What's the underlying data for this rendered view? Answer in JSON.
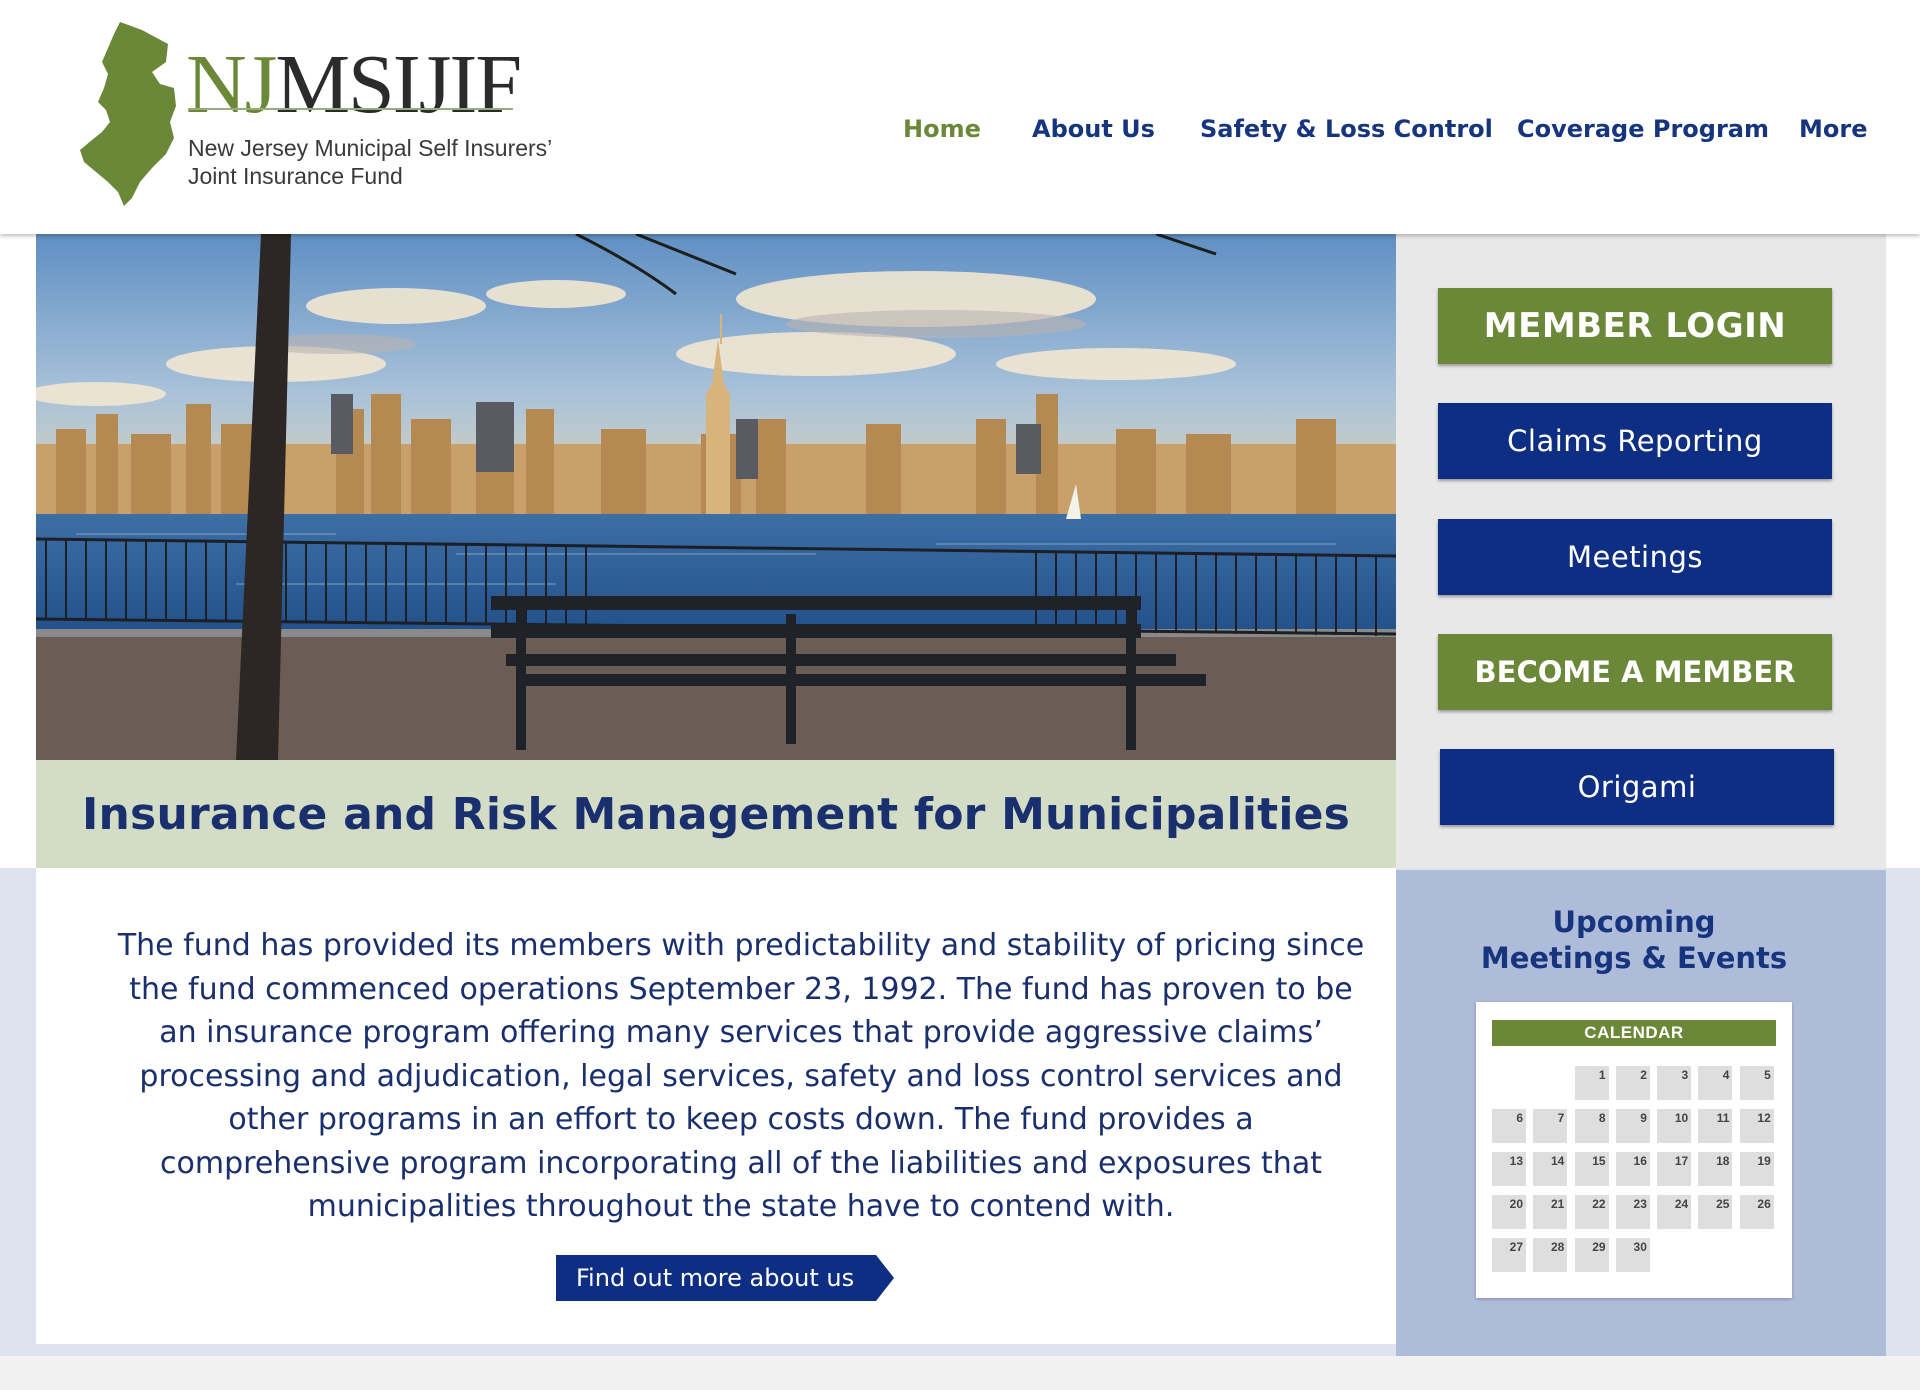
{
  "header": {
    "logo": {
      "wordmark_nj": "NJ",
      "wordmark_rest": "MSIJIF",
      "subtitle_line1": "New Jersey Municipal Self Insurers’",
      "subtitle_line2": "Joint Insurance Fund"
    },
    "nav": [
      {
        "label": "Home",
        "active": true
      },
      {
        "label": "About Us",
        "active": false
      },
      {
        "label": "Safety & Loss Control",
        "active": false
      },
      {
        "label": "Coverage Program",
        "active": false
      },
      {
        "label": "More",
        "active": false
      }
    ]
  },
  "hero": {
    "tagline": "Insurance and Risk Management for Municipalities"
  },
  "sidebar": {
    "buttons": [
      {
        "label": "MEMBER LOGIN",
        "style": "green"
      },
      {
        "label": "Claims Reporting",
        "style": "blue"
      },
      {
        "label": "Meetings",
        "style": "blue"
      },
      {
        "label": "BECOME A MEMBER",
        "style": "green"
      },
      {
        "label": "Origami",
        "style": "blue"
      }
    ]
  },
  "about": {
    "body": "The fund has provided its members with predictability and stability of pricing since the fund commenced operations September 23, 1992. The fund has proven to be an insurance program offering many services that provide aggressive claims’ processing and adjudication, legal services, safety and loss control services and other programs in an effort to keep costs down. The fund provides a comprehensive program incorporating all of the liabilities and exposures that municipalities throughout the state have to contend with.",
    "cta_label": "Find out more about us"
  },
  "events": {
    "title_line1": "Upcoming",
    "title_line2": "Meetings & Events",
    "calendar": {
      "header": "CALENDAR",
      "leading_blanks": 2,
      "days": [
        "1",
        "2",
        "3",
        "4",
        "5",
        "6",
        "7",
        "8",
        "9",
        "10",
        "11",
        "12",
        "13",
        "14",
        "15",
        "16",
        "17",
        "18",
        "19",
        "20",
        "21",
        "22",
        "23",
        "24",
        "25",
        "26",
        "27",
        "28",
        "29",
        "30"
      ]
    }
  },
  "colors": {
    "brand_green": "#6b8838",
    "brand_blue": "#0d2e82",
    "nav_blue": "#17357e",
    "tagline_band": "#d3dcc4",
    "events_panel": "#aebbd9"
  }
}
